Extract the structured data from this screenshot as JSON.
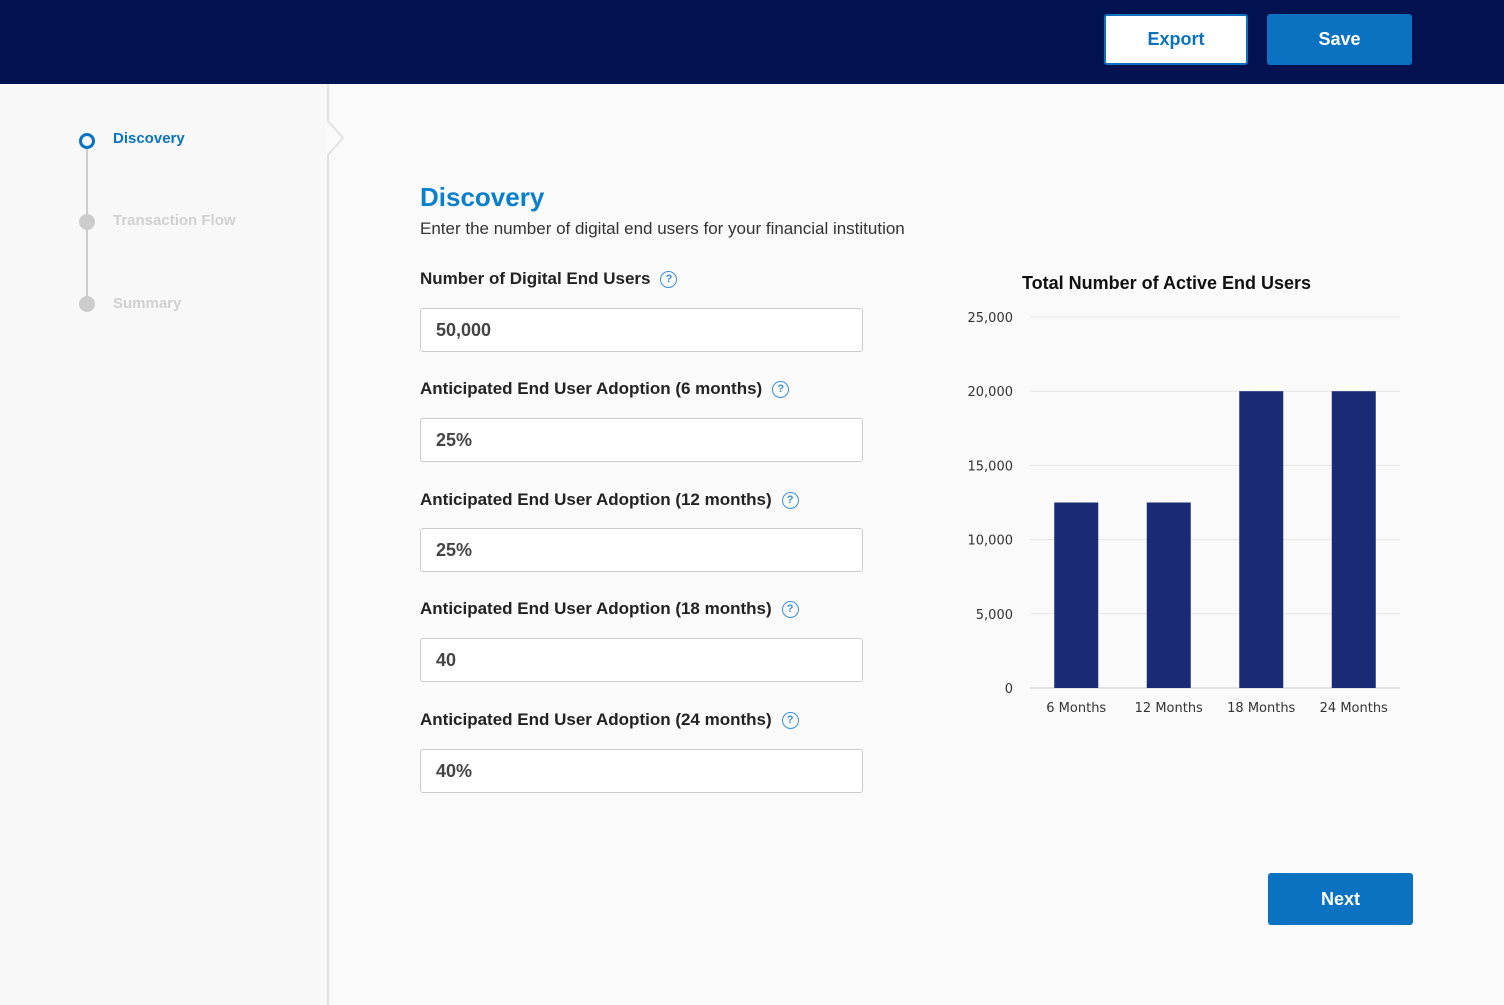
{
  "header": {
    "export_label": "Export",
    "save_label": "Save"
  },
  "steps": [
    {
      "label": "Discovery",
      "state": "active"
    },
    {
      "label": "Transaction Flow",
      "state": "inactive"
    },
    {
      "label": "Summary",
      "state": "inactive"
    }
  ],
  "main": {
    "title": "Discovery",
    "subtitle": "Enter the number of digital end users for your financial institution",
    "fields": [
      {
        "label": "Number of Digital End Users",
        "value": "50,000"
      },
      {
        "label": "Anticipated End User Adoption (6 months)",
        "value": "25%"
      },
      {
        "label": "Anticipated End User Adoption (12 months)",
        "value": "25%"
      },
      {
        "label": "Anticipated End User Adoption (18 months)",
        "value": "40"
      },
      {
        "label": "Anticipated End User Adoption (24 months)",
        "value": "40%"
      }
    ],
    "next_label": "Next"
  },
  "colors": {
    "header": "#02114f",
    "accent": "#0a72c0",
    "bar": "#1b2a75"
  },
  "chart_data": {
    "type": "bar",
    "title": "Total Number of Active End Users",
    "categories": [
      "6 Months",
      "12 Months",
      "18 Months",
      "24 Months"
    ],
    "values": [
      12500,
      12500,
      20000,
      20000
    ],
    "ylim": [
      0,
      25000
    ],
    "yticks": [
      "0",
      "5,000",
      "10,000",
      "15,000",
      "20,000",
      "25,000"
    ],
    "grid": true
  }
}
